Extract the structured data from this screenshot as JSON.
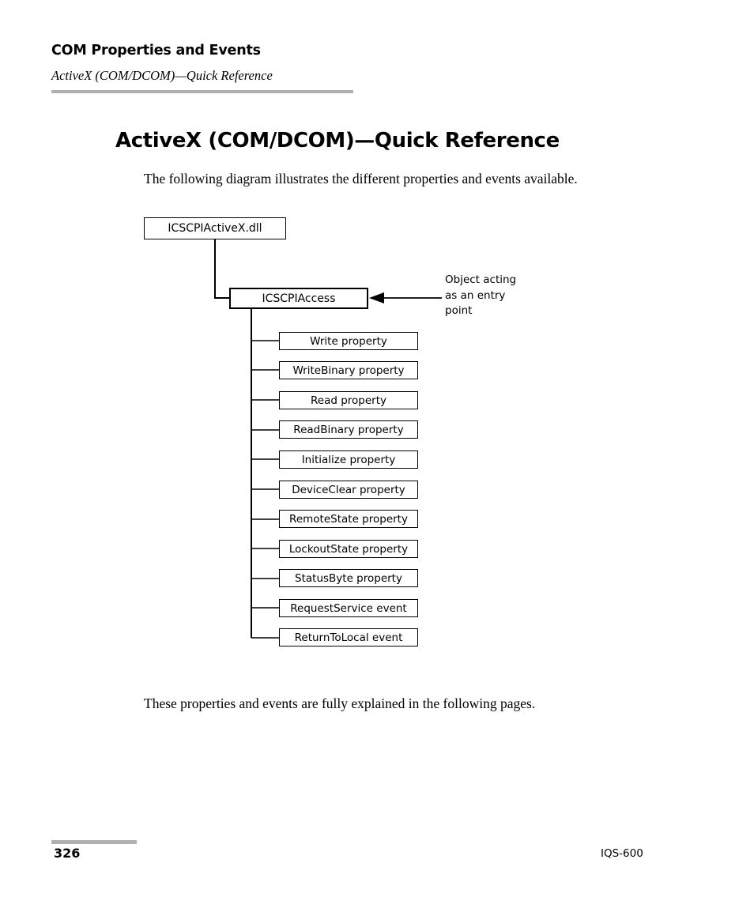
{
  "header": {
    "chapter_title": "COM Properties and Events",
    "section_subtitle": "ActiveX (COM/DCOM)—Quick Reference"
  },
  "page_title": "ActiveX (COM/DCOM)—Quick Reference",
  "body": {
    "intro": "The following diagram illustrates the different properties and events available.",
    "outro": "These properties and events are fully explained in the following pages."
  },
  "diagram": {
    "root_node": "ICSCPIActiveX.dll",
    "entry_node": "ICSCPIAccess",
    "annotation": "Object acting\nas an entry\npoint",
    "members": [
      {
        "label": "Write property"
      },
      {
        "label": "WriteBinary property"
      },
      {
        "label": "Read property"
      },
      {
        "label": "ReadBinary property"
      },
      {
        "label": "Initialize property"
      },
      {
        "label": "DeviceClear property"
      },
      {
        "label": "RemoteState property"
      },
      {
        "label": "LockoutState property"
      },
      {
        "label": "StatusByte property"
      },
      {
        "label": "RequestService event"
      },
      {
        "label": "ReturnToLocal event"
      }
    ]
  },
  "footer": {
    "page_number": "326",
    "model": "IQS-600"
  },
  "colors": {
    "rule_gray": "#b0b0b0",
    "ink": "#000000",
    "paper": "#ffffff"
  }
}
